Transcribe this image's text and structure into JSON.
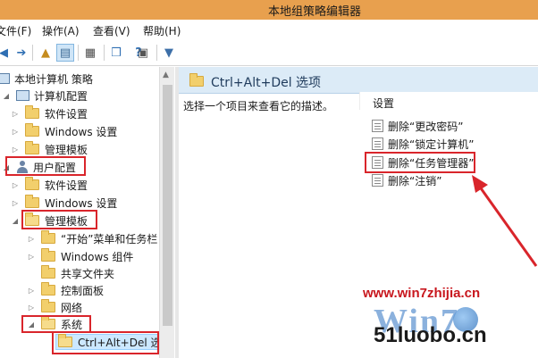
{
  "window": {
    "title": "本地组策略编辑器"
  },
  "menu": {
    "items": [
      "文件(F)",
      "操作(A)",
      "查看(V)",
      "帮助(H)"
    ]
  },
  "toolbar": {
    "icons": [
      "back-icon",
      "forward-icon",
      "up-folder-icon",
      "show-tree-icon",
      "properties-icon",
      "export-icon",
      "help-icon",
      "show-hide-pane-icon",
      "filter-icon"
    ]
  },
  "tree": {
    "root": "本地计算机 策略",
    "computer_config": "计算机配置",
    "computer_children": [
      "软件设置",
      "Windows 设置",
      "管理模板"
    ],
    "user_config": "用户配置",
    "user_children": [
      "软件设置",
      "Windows 设置",
      "管理模板"
    ],
    "admin_children": [
      "“开始”菜单和任务栏",
      "Windows 组件",
      "共享文件夹",
      "控制面板",
      "网络",
      "系统"
    ],
    "system_children": [
      "Ctrl+Alt+Del 选项"
    ]
  },
  "right": {
    "header_title": "Ctrl+Alt+Del 选项",
    "description": "选择一个项目来查看它的描述。",
    "column_header": "设置",
    "settings": [
      "删除“更改密码”",
      "删除“锁定计算机”",
      "删除“任务管理器”",
      "删除“注销”"
    ]
  },
  "watermark": {
    "url": "www.win7zhijia.cn",
    "logo_text": "Win7",
    "site2": "51luobo.cn"
  },
  "colors": {
    "title_bar": "#e8a04e",
    "highlight_box": "#d9252b",
    "header_bg": "#dcebf7"
  }
}
